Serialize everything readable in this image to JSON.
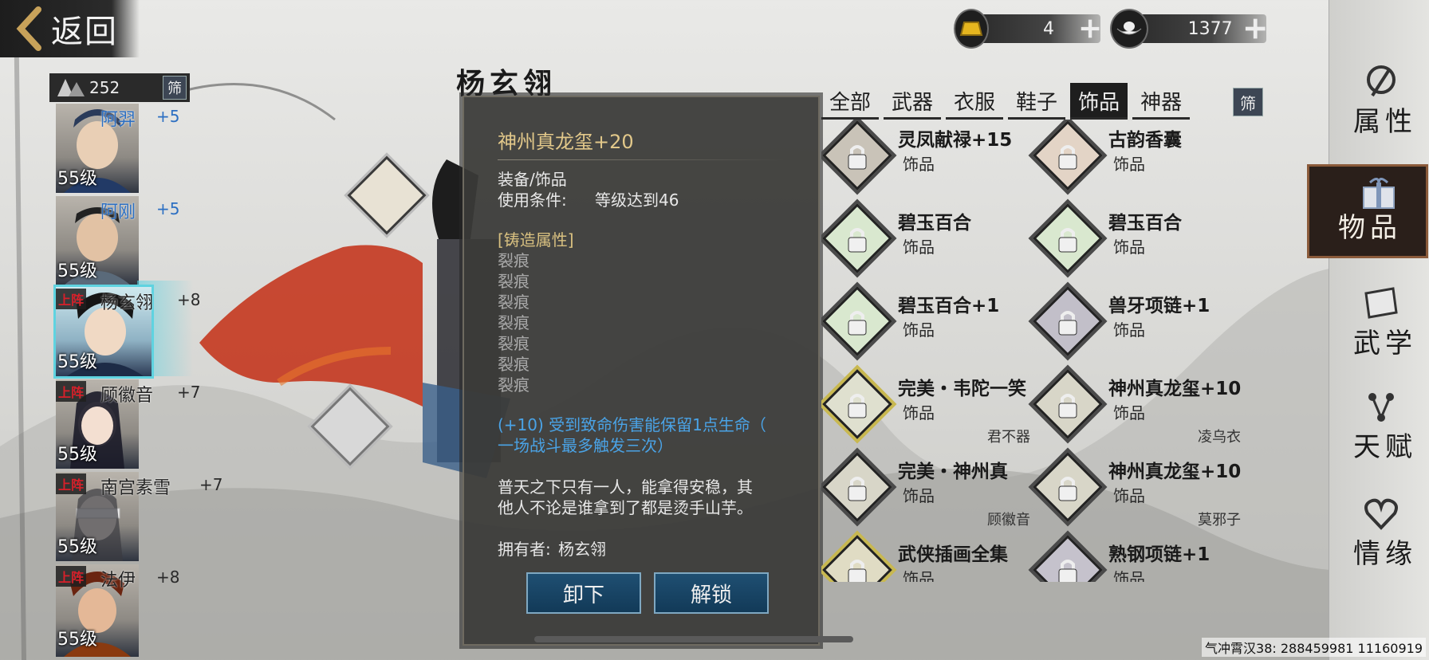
{
  "nav": {
    "back_label": "返回"
  },
  "currency": {
    "gold": "4",
    "silver": "1377"
  },
  "roster": {
    "count": "252",
    "filter_label": "筛",
    "heroes": [
      {
        "name": "阿羿",
        "bonus": "+5",
        "level": "55级",
        "deploy": ""
      },
      {
        "name": "阿刚",
        "bonus": "+5",
        "level": "55级",
        "deploy": ""
      },
      {
        "name": "杨玄翎",
        "bonus": "+8",
        "level": "55级",
        "deploy": "上阵"
      },
      {
        "name": "顾徽音",
        "bonus": "+7",
        "level": "55级",
        "deploy": "上阵"
      },
      {
        "name": "南宫素雪",
        "bonus": "+7",
        "level": "55级",
        "deploy": "上阵"
      },
      {
        "name": "法伊",
        "bonus": "+8",
        "level": "55级",
        "deploy": "上阵"
      }
    ]
  },
  "character": {
    "name": "杨玄翎"
  },
  "tooltip": {
    "title": "神州真龙玺+20",
    "type": "装备/饰品",
    "req_label": "使用条件:",
    "req_value": "等级达到46",
    "forge_header": "[铸造属性]",
    "forge_lines": [
      "裂痕",
      "裂痕",
      "裂痕",
      "裂痕",
      "裂痕",
      "裂痕",
      "裂痕"
    ],
    "effect_line1": "(+10) 受到致命伤害能保留1点生命（",
    "effect_line2": "一场战斗最多触发三次）",
    "desc_line1": "普天之下只有一人，能拿得安稳，其",
    "desc_line2": "他人不论是谁拿到了都是烫手山芋。",
    "owner_label": "拥有者:",
    "owner": "杨玄翎",
    "unequip_label": "卸下",
    "unlock_label": "解锁"
  },
  "tabs": {
    "items": [
      "全部",
      "武器",
      "衣服",
      "鞋子",
      "饰品",
      "神器"
    ],
    "active": "饰品",
    "filter_label": "筛"
  },
  "items": [
    {
      "name": "灵凤献禄+15",
      "category": "饰品",
      "owner": ""
    },
    {
      "name": "古韵香囊",
      "category": "饰品",
      "owner": ""
    },
    {
      "name": "碧玉百合",
      "category": "饰品",
      "owner": ""
    },
    {
      "name": "碧玉百合",
      "category": "饰品",
      "owner": ""
    },
    {
      "name": "碧玉百合+1",
      "category": "饰品",
      "owner": ""
    },
    {
      "name": "兽牙项链+1",
      "category": "饰品",
      "owner": ""
    },
    {
      "name": "完美・韦陀一笑",
      "category": "饰品",
      "owner": "君不器"
    },
    {
      "name": "神州真龙玺+10",
      "category": "饰品",
      "owner": "凌乌衣"
    },
    {
      "name": "完美・神州真",
      "category": "饰品",
      "owner": "顾徽音"
    },
    {
      "name": "神州真龙玺+10",
      "category": "饰品",
      "owner": "莫邪子"
    },
    {
      "name": "武侠插画全集",
      "category": "饰品",
      "owner": ""
    },
    {
      "name": "熟钢项链+1",
      "category": "饰品",
      "owner": ""
    }
  ],
  "right_nav": {
    "items": [
      "属性",
      "物品",
      "武学",
      "天赋",
      "情缘"
    ],
    "active": "物品"
  },
  "footer": {
    "player_id": "气冲霄汉38: 288459981  11160919"
  }
}
